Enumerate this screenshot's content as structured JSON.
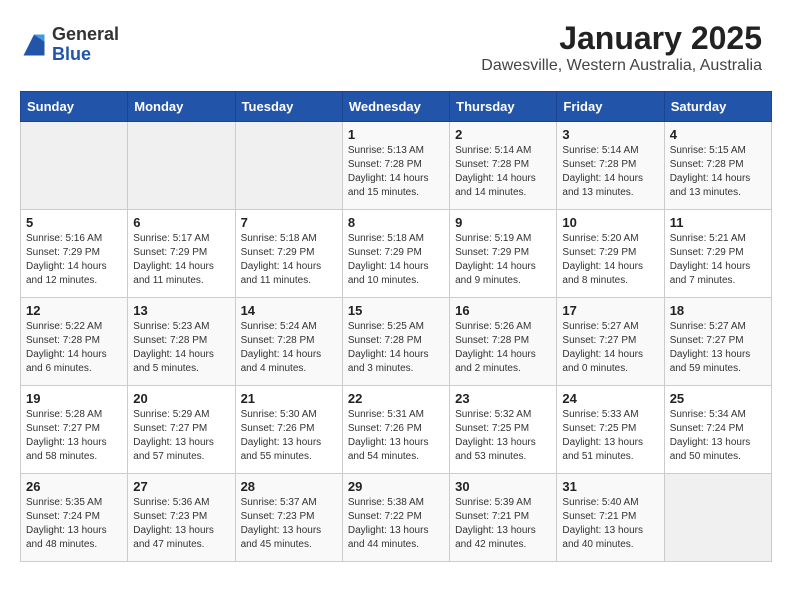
{
  "header": {
    "title": "January 2025",
    "subtitle": "Dawesville, Western Australia, Australia",
    "logo_general": "General",
    "logo_blue": "Blue"
  },
  "days_of_week": [
    "Sunday",
    "Monday",
    "Tuesday",
    "Wednesday",
    "Thursday",
    "Friday",
    "Saturday"
  ],
  "weeks": [
    [
      {
        "day": "",
        "info": ""
      },
      {
        "day": "",
        "info": ""
      },
      {
        "day": "",
        "info": ""
      },
      {
        "day": "1",
        "info": "Sunrise: 5:13 AM\nSunset: 7:28 PM\nDaylight: 14 hours\nand 15 minutes."
      },
      {
        "day": "2",
        "info": "Sunrise: 5:14 AM\nSunset: 7:28 PM\nDaylight: 14 hours\nand 14 minutes."
      },
      {
        "day": "3",
        "info": "Sunrise: 5:14 AM\nSunset: 7:28 PM\nDaylight: 14 hours\nand 13 minutes."
      },
      {
        "day": "4",
        "info": "Sunrise: 5:15 AM\nSunset: 7:28 PM\nDaylight: 14 hours\nand 13 minutes."
      }
    ],
    [
      {
        "day": "5",
        "info": "Sunrise: 5:16 AM\nSunset: 7:29 PM\nDaylight: 14 hours\nand 12 minutes."
      },
      {
        "day": "6",
        "info": "Sunrise: 5:17 AM\nSunset: 7:29 PM\nDaylight: 14 hours\nand 11 minutes."
      },
      {
        "day": "7",
        "info": "Sunrise: 5:18 AM\nSunset: 7:29 PM\nDaylight: 14 hours\nand 11 minutes."
      },
      {
        "day": "8",
        "info": "Sunrise: 5:18 AM\nSunset: 7:29 PM\nDaylight: 14 hours\nand 10 minutes."
      },
      {
        "day": "9",
        "info": "Sunrise: 5:19 AM\nSunset: 7:29 PM\nDaylight: 14 hours\nand 9 minutes."
      },
      {
        "day": "10",
        "info": "Sunrise: 5:20 AM\nSunset: 7:29 PM\nDaylight: 14 hours\nand 8 minutes."
      },
      {
        "day": "11",
        "info": "Sunrise: 5:21 AM\nSunset: 7:29 PM\nDaylight: 14 hours\nand 7 minutes."
      }
    ],
    [
      {
        "day": "12",
        "info": "Sunrise: 5:22 AM\nSunset: 7:28 PM\nDaylight: 14 hours\nand 6 minutes."
      },
      {
        "day": "13",
        "info": "Sunrise: 5:23 AM\nSunset: 7:28 PM\nDaylight: 14 hours\nand 5 minutes."
      },
      {
        "day": "14",
        "info": "Sunrise: 5:24 AM\nSunset: 7:28 PM\nDaylight: 14 hours\nand 4 minutes."
      },
      {
        "day": "15",
        "info": "Sunrise: 5:25 AM\nSunset: 7:28 PM\nDaylight: 14 hours\nand 3 minutes."
      },
      {
        "day": "16",
        "info": "Sunrise: 5:26 AM\nSunset: 7:28 PM\nDaylight: 14 hours\nand 2 minutes."
      },
      {
        "day": "17",
        "info": "Sunrise: 5:27 AM\nSunset: 7:27 PM\nDaylight: 14 hours\nand 0 minutes."
      },
      {
        "day": "18",
        "info": "Sunrise: 5:27 AM\nSunset: 7:27 PM\nDaylight: 13 hours\nand 59 minutes."
      }
    ],
    [
      {
        "day": "19",
        "info": "Sunrise: 5:28 AM\nSunset: 7:27 PM\nDaylight: 13 hours\nand 58 minutes."
      },
      {
        "day": "20",
        "info": "Sunrise: 5:29 AM\nSunset: 7:27 PM\nDaylight: 13 hours\nand 57 minutes."
      },
      {
        "day": "21",
        "info": "Sunrise: 5:30 AM\nSunset: 7:26 PM\nDaylight: 13 hours\nand 55 minutes."
      },
      {
        "day": "22",
        "info": "Sunrise: 5:31 AM\nSunset: 7:26 PM\nDaylight: 13 hours\nand 54 minutes."
      },
      {
        "day": "23",
        "info": "Sunrise: 5:32 AM\nSunset: 7:25 PM\nDaylight: 13 hours\nand 53 minutes."
      },
      {
        "day": "24",
        "info": "Sunrise: 5:33 AM\nSunset: 7:25 PM\nDaylight: 13 hours\nand 51 minutes."
      },
      {
        "day": "25",
        "info": "Sunrise: 5:34 AM\nSunset: 7:24 PM\nDaylight: 13 hours\nand 50 minutes."
      }
    ],
    [
      {
        "day": "26",
        "info": "Sunrise: 5:35 AM\nSunset: 7:24 PM\nDaylight: 13 hours\nand 48 minutes."
      },
      {
        "day": "27",
        "info": "Sunrise: 5:36 AM\nSunset: 7:23 PM\nDaylight: 13 hours\nand 47 minutes."
      },
      {
        "day": "28",
        "info": "Sunrise: 5:37 AM\nSunset: 7:23 PM\nDaylight: 13 hours\nand 45 minutes."
      },
      {
        "day": "29",
        "info": "Sunrise: 5:38 AM\nSunset: 7:22 PM\nDaylight: 13 hours\nand 44 minutes."
      },
      {
        "day": "30",
        "info": "Sunrise: 5:39 AM\nSunset: 7:21 PM\nDaylight: 13 hours\nand 42 minutes."
      },
      {
        "day": "31",
        "info": "Sunrise: 5:40 AM\nSunset: 7:21 PM\nDaylight: 13 hours\nand 40 minutes."
      },
      {
        "day": "",
        "info": ""
      }
    ]
  ]
}
